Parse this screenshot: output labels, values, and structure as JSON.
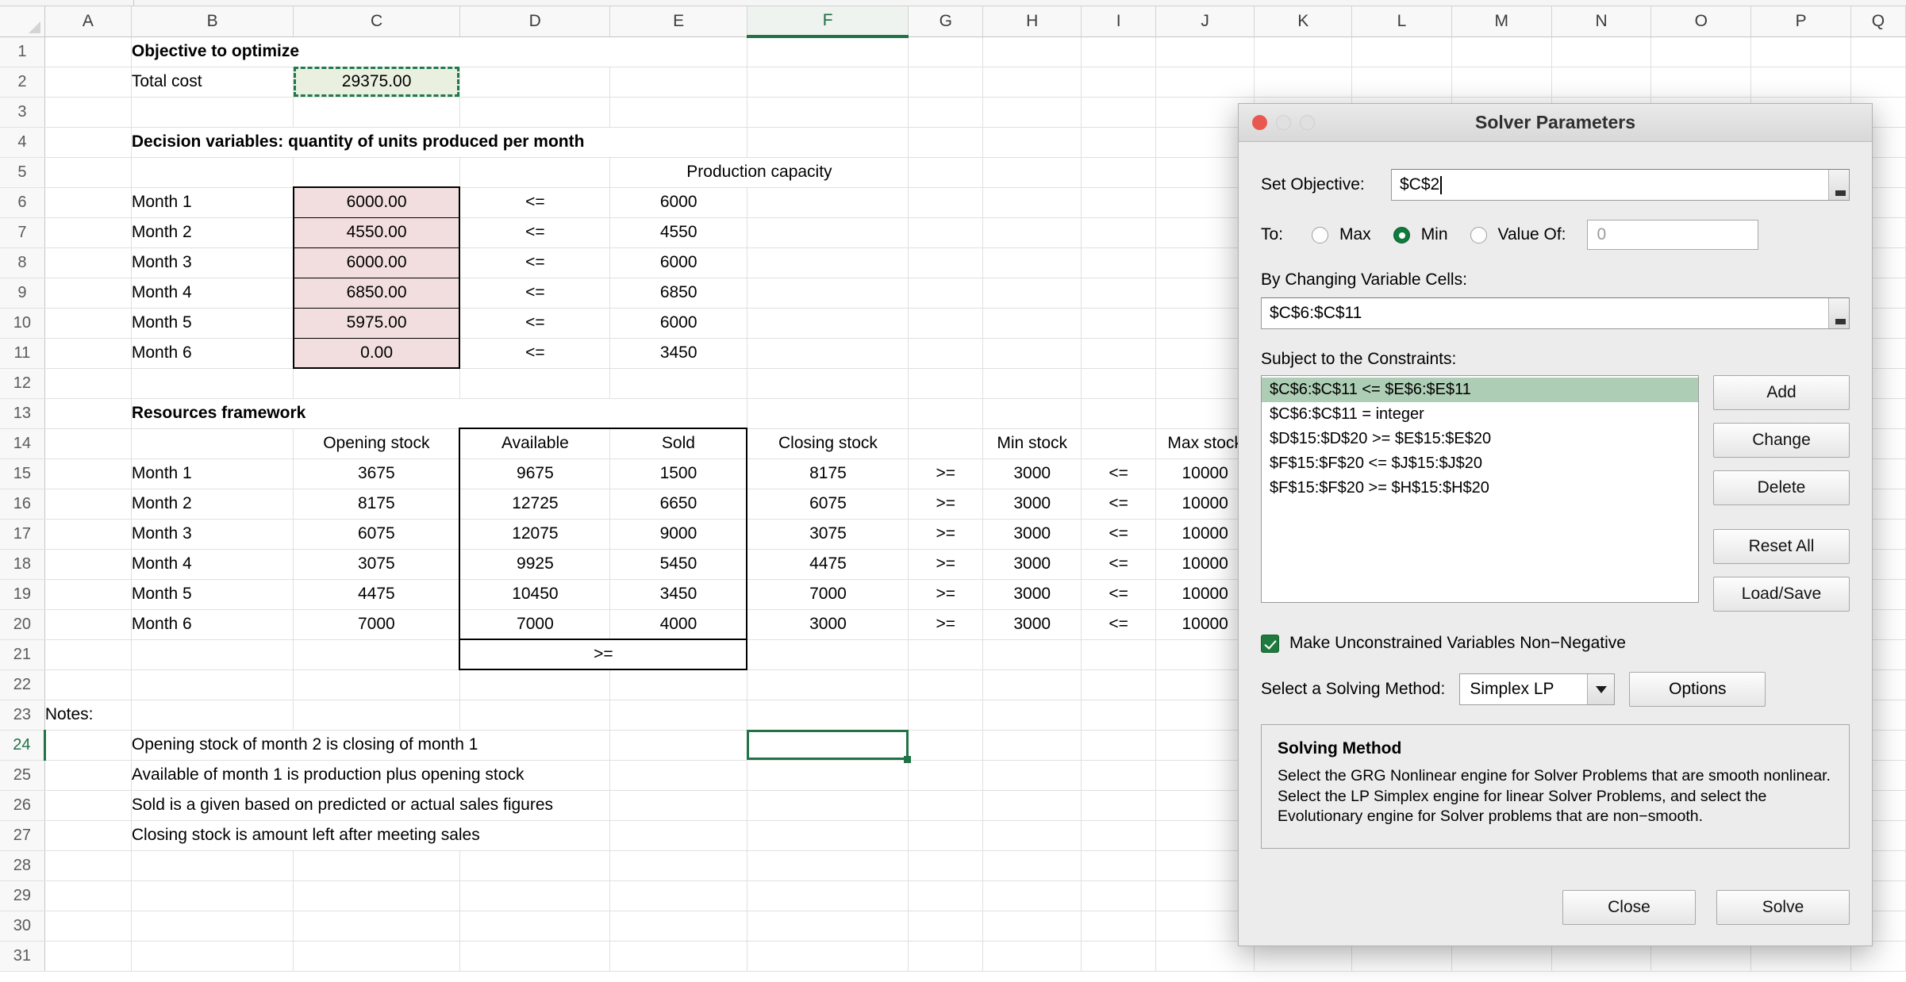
{
  "spreadsheet": {
    "columns": [
      "A",
      "B",
      "C",
      "D",
      "E",
      "F",
      "G",
      "H",
      "I",
      "J",
      "K",
      "L",
      "M",
      "N",
      "O",
      "P",
      "Q"
    ],
    "active_column": "F",
    "active_row": "24",
    "selected_cell": "F24",
    "rows": [
      {
        "n": "1",
        "B": "Objective to optimize"
      },
      {
        "n": "2",
        "B": "Total cost",
        "C": "29375.00"
      },
      {
        "n": "3"
      },
      {
        "n": "4",
        "B": "Decision variables: quantity of units produced per month"
      },
      {
        "n": "5",
        "E": "Production capacity"
      },
      {
        "n": "6",
        "B": "Month 1",
        "C": "6000.00",
        "D": "<=",
        "E": "6000"
      },
      {
        "n": "7",
        "B": "Month 2",
        "C": "4550.00",
        "D": "<=",
        "E": "4550"
      },
      {
        "n": "8",
        "B": "Month 3",
        "C": "6000.00",
        "D": "<=",
        "E": "6000"
      },
      {
        "n": "9",
        "B": "Month 4",
        "C": "6850.00",
        "D": "<=",
        "E": "6850"
      },
      {
        "n": "10",
        "B": "Month 5",
        "C": "5975.00",
        "D": "<=",
        "E": "6000"
      },
      {
        "n": "11",
        "B": "Month 6",
        "C": "0.00",
        "D": "<=",
        "E": "3450"
      },
      {
        "n": "12"
      },
      {
        "n": "13",
        "B": "Resources framework"
      },
      {
        "n": "14",
        "C": "Opening stock",
        "D": "Available",
        "E": "Sold",
        "F": "Closing stock",
        "H": "Min stock",
        "J": "Max stock"
      },
      {
        "n": "15",
        "B": "Month 1",
        "C": "3675",
        "D": "9675",
        "E": "1500",
        "F": "8175",
        "G": ">=",
        "H": "3000",
        "I": "<=",
        "J": "10000"
      },
      {
        "n": "16",
        "B": "Month 2",
        "C": "8175",
        "D": "12725",
        "E": "6650",
        "F": "6075",
        "G": ">=",
        "H": "3000",
        "I": "<=",
        "J": "10000"
      },
      {
        "n": "17",
        "B": "Month 3",
        "C": "6075",
        "D": "12075",
        "E": "9000",
        "F": "3075",
        "G": ">=",
        "H": "3000",
        "I": "<=",
        "J": "10000"
      },
      {
        "n": "18",
        "B": "Month 4",
        "C": "3075",
        "D": "9925",
        "E": "5450",
        "F": "4475",
        "G": ">=",
        "H": "3000",
        "I": "<=",
        "J": "10000"
      },
      {
        "n": "19",
        "B": "Month 5",
        "C": "4475",
        "D": "10450",
        "E": "3450",
        "F": "7000",
        "G": ">=",
        "H": "3000",
        "I": "<=",
        "J": "10000"
      },
      {
        "n": "20",
        "B": "Month 6",
        "C": "7000",
        "D": "7000",
        "E": "4000",
        "F": "3000",
        "G": ">=",
        "H": "3000",
        "I": "<=",
        "J": "10000"
      },
      {
        "n": "21",
        "D": ">="
      },
      {
        "n": "22"
      },
      {
        "n": "23",
        "A": "Notes:"
      },
      {
        "n": "24",
        "B": "Opening stock of month 2 is closing of month 1"
      },
      {
        "n": "25",
        "B": "Available of month 1 is production plus opening stock"
      },
      {
        "n": "26",
        "B": "Sold is a given based on predicted or actual sales figures"
      },
      {
        "n": "27",
        "B": "Closing stock is amount left after meeting sales"
      },
      {
        "n": "28"
      },
      {
        "n": "29"
      },
      {
        "n": "30"
      },
      {
        "n": "31"
      }
    ]
  },
  "solver": {
    "title": "Solver Parameters",
    "set_objective_label": "Set Objective:",
    "set_objective_value": "$C$2",
    "to_label": "To:",
    "option_max": "Max",
    "option_min": "Min",
    "option_value_of": "Value Of:",
    "selected_goal": "Min",
    "value_of_placeholder": "0",
    "changing_cells_label": "By Changing Variable Cells:",
    "changing_cells_value": "$C$6:$C$11",
    "constraints_label": "Subject to the Constraints:",
    "constraints": [
      {
        "text": "$C$6:$C$11 <= $E$6:$E$11",
        "selected": true
      },
      {
        "text": "$C$6:$C$11 = integer",
        "selected": false
      },
      {
        "text": "$D$15:$D$20 >= $E$15:$E$20",
        "selected": false
      },
      {
        "text": "$F$15:$F$20 <= $J$15:$J$20",
        "selected": false
      },
      {
        "text": "$F$15:$F$20 >= $H$15:$H$20",
        "selected": false
      }
    ],
    "buttons": {
      "add": "Add",
      "change": "Change",
      "delete": "Delete",
      "reset_all": "Reset All",
      "load_save": "Load/Save",
      "options": "Options",
      "close": "Close",
      "solve": "Solve"
    },
    "nonneg_label": "Make Unconstrained Variables Non−Negative",
    "nonneg_checked": true,
    "method_label": "Select a Solving Method:",
    "method_value": "Simplex LP",
    "info_title": "Solving Method",
    "info_body": "Select the GRG Nonlinear engine for Solver Problems that are smooth nonlinear. Select the LP Simplex engine for linear Solver Problems, and select the Evolutionary engine for Solver problems that are non−smooth.",
    "accent_color": "#217346",
    "selected_constraint_color": "#aecdb5"
  }
}
